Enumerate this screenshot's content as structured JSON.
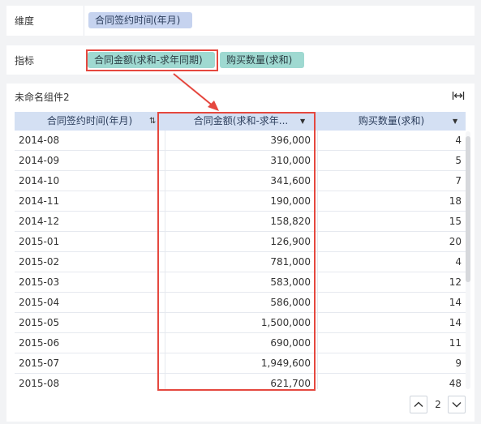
{
  "dimension_row": {
    "label": "维度",
    "fields": [
      "合同签约时间(年月)"
    ]
  },
  "metric_row": {
    "label": "指标",
    "fields": [
      "合同金额(求和-求年同期)",
      "购买数量(求和)"
    ]
  },
  "widget": {
    "title": "未命名组件2",
    "columns": [
      {
        "label": "合同签约时间(年月)",
        "icon": "sort-icon"
      },
      {
        "label": "合同金额(求和-求年...",
        "icon": "dropdown-icon"
      },
      {
        "label": "购买数量(求和)",
        "icon": "dropdown-icon"
      }
    ],
    "rows": [
      {
        "date": "2014-08",
        "amount": "396,000",
        "qty": "4"
      },
      {
        "date": "2014-09",
        "amount": "310,000",
        "qty": "5"
      },
      {
        "date": "2014-10",
        "amount": "341,600",
        "qty": "7"
      },
      {
        "date": "2014-11",
        "amount": "190,000",
        "qty": "18"
      },
      {
        "date": "2014-12",
        "amount": "158,820",
        "qty": "15"
      },
      {
        "date": "2015-01",
        "amount": "126,900",
        "qty": "20"
      },
      {
        "date": "2015-02",
        "amount": "781,000",
        "qty": "4"
      },
      {
        "date": "2015-03",
        "amount": "583,000",
        "qty": "12"
      },
      {
        "date": "2015-04",
        "amount": "586,000",
        "qty": "14"
      },
      {
        "date": "2015-05",
        "amount": "1,500,000",
        "qty": "14"
      },
      {
        "date": "2015-06",
        "amount": "690,000",
        "qty": "11"
      },
      {
        "date": "2015-07",
        "amount": "1,949,600",
        "qty": "9"
      },
      {
        "date": "2015-08",
        "amount": "621,700",
        "qty": "48"
      }
    ],
    "pagination": {
      "current_page": "2"
    }
  },
  "colors": {
    "dimension_pill": "#c6d3ef",
    "metric_pill": "#9fd9d1",
    "table_header": "#d4e0f3",
    "annotation": "#e5483f"
  }
}
